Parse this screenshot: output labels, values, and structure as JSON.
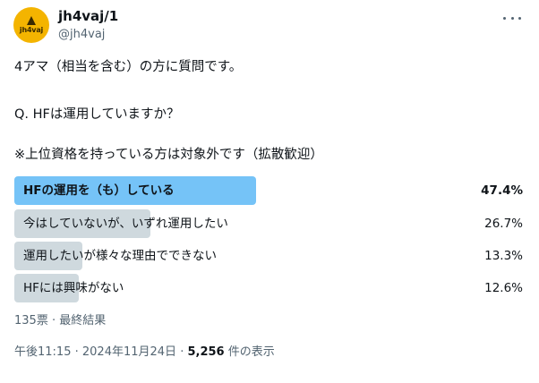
{
  "author": {
    "display_name": "jh4vaj/1",
    "handle": "@jh4vaj",
    "avatar_text": "jh4vaj",
    "avatar_color": "#f4b400"
  },
  "more_icon": "more-horizontal-icon",
  "tweet": {
    "line1": "4アマ（相当を含む）の方に質問です。",
    "line2": "Q. HFは運用していますか？",
    "line3": "※上位資格を持っている方は対象外です（拡散歓迎）"
  },
  "poll": {
    "options": [
      {
        "label": "HFの運用を（も）している",
        "percent_text": "47.4%",
        "percent": 47.4,
        "winner": true
      },
      {
        "label": "今はしていないが、いずれ運用したい",
        "percent_text": "26.7%",
        "percent": 26.7,
        "winner": false
      },
      {
        "label": "運用したいが様々な理由でできない",
        "percent_text": "13.3%",
        "percent": 13.3,
        "winner": false
      },
      {
        "label": "HFには興味がない",
        "percent_text": "12.6%",
        "percent": 12.6,
        "winner": false
      }
    ],
    "summary": "135票 · 最終結果",
    "winner_color": "#75c3f7",
    "other_color": "#cfd9de"
  },
  "meta": {
    "time": "午後11:15",
    "separator": "·",
    "date": "2024年11月24日",
    "views_count": "5,256",
    "views_label": "件の表示"
  }
}
